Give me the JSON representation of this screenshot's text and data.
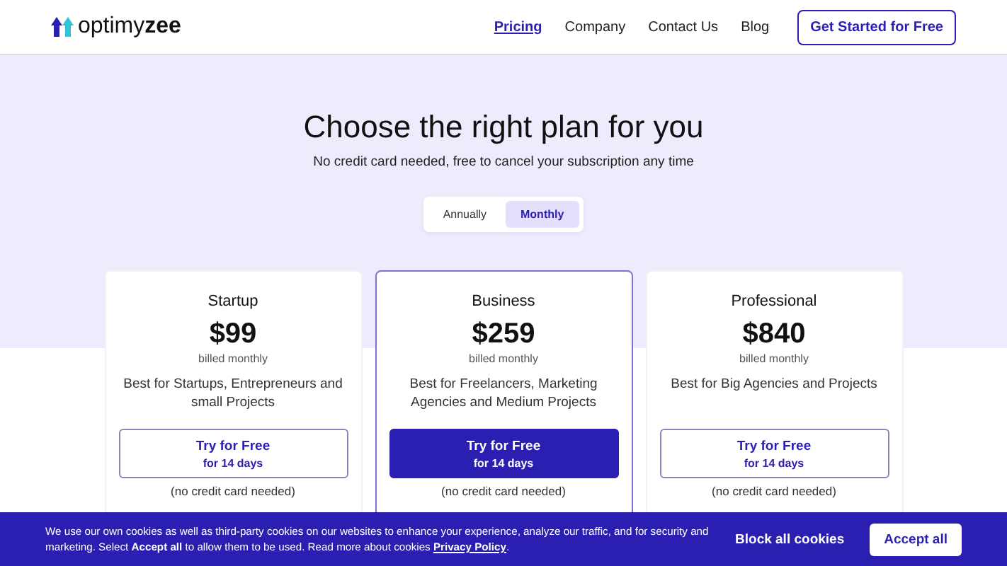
{
  "header": {
    "logo": "optimy",
    "logo_bold": "zee",
    "nav": [
      {
        "label": "Pricing",
        "selected": true
      },
      {
        "label": "Company",
        "selected": false
      },
      {
        "label": "Contact Us",
        "selected": false
      },
      {
        "label": "Blog",
        "selected": false
      }
    ],
    "cta": "Get Started for Free"
  },
  "hero": {
    "title": "Choose the right plan for you",
    "subtitle": "No credit card needed, free to cancel your subscription any time",
    "billing": [
      {
        "label": "Annually",
        "selected": false
      },
      {
        "label": "Monthly",
        "selected": true
      }
    ]
  },
  "plans": [
    {
      "name": "Startup",
      "price": "$99",
      "period": "billed monthly",
      "description": "Best for Startups, Entrepreneurs and small Projects",
      "button": "Try for Free",
      "button_sub": "for 14 days",
      "note": "(no credit card needed)",
      "featured": false
    },
    {
      "name": "Business",
      "price": "$259",
      "period": "billed monthly",
      "description": "Best for Freelancers, Marketing Agencies and Medium Projects",
      "button": "Try for Free",
      "button_sub": "for 14 days",
      "note": "(no credit card needed)",
      "featured": true
    },
    {
      "name": "Professional",
      "price": "$840",
      "period": "billed monthly",
      "description": "Best for Big Agencies and Projects",
      "button": "Try for Free",
      "button_sub": "for 14 days",
      "note": "(no credit card needed)",
      "featured": false
    }
  ],
  "cookie_banner": {
    "text": "We use our own cookies as well as third-party cookies on our websites to enhance your experience, analyze our traffic, and for security and marketing. Select **Accept all** to allow them to be used. Read more about cookies ",
    "link": "Privacy Policy",
    "after": ".",
    "buttons": [
      "Block all cookies",
      "Accept all"
    ]
  }
}
